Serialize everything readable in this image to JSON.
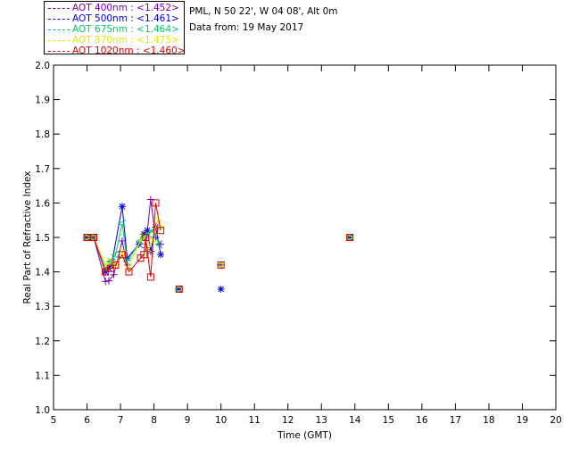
{
  "header": {
    "site_line": "PML, N 50 22', W 04 08', Alt 0m",
    "date_line": "Data from: 19 May 2017"
  },
  "legend": [
    {
      "label": "AOT  400nm : <1.452>",
      "color": "#7b00b8"
    },
    {
      "label": "AOT  500nm : <1.461>",
      "color": "#0000dd"
    },
    {
      "label": "AOT  675nm : <1.464>",
      "color": "#00cc66"
    },
    {
      "label": "AOT  870nm : <1.475>",
      "color": "#e6e600"
    },
    {
      "label": "AOT 1020nm : <1.460>",
      "color": "#dd0000"
    }
  ],
  "chart_data": {
    "type": "scatter",
    "xlabel": "Time (GMT)",
    "ylabel": "Real Part of Refractive Index",
    "xlim": [
      5,
      20
    ],
    "ylim": [
      1.0,
      2.0
    ],
    "xticks": [
      "5",
      "6",
      "7",
      "8",
      "9",
      "10",
      "11",
      "12",
      "13",
      "14",
      "15",
      "16",
      "17",
      "18",
      "19",
      "20"
    ],
    "yticks": [
      "1.0",
      "1.1",
      "1.2",
      "1.3",
      "1.4",
      "1.5",
      "1.6",
      "1.7",
      "1.8",
      "1.9",
      "2.0"
    ],
    "series": [
      {
        "name": "AOT  400nm",
        "color": "#7b00b8",
        "marker": "plus",
        "x": [
          6.0,
          6.2,
          6.55,
          6.65,
          6.8,
          7.05,
          7.2,
          7.75,
          7.9,
          8.05,
          8.2,
          8.75,
          10.0,
          13.85
        ],
        "y": [
          1.5,
          1.5,
          1.372,
          1.374,
          1.392,
          1.49,
          1.42,
          1.47,
          1.61,
          1.5,
          1.48,
          1.35,
          1.42,
          1.5
        ]
      },
      {
        "name": "AOT  500nm",
        "color": "#0000dd",
        "marker": "star",
        "x": [
          6.0,
          6.2,
          6.55,
          6.65,
          6.75,
          7.05,
          7.2,
          7.55,
          7.7,
          7.8,
          7.9,
          8.05,
          8.2,
          8.75,
          10.0,
          13.85
        ],
        "y": [
          1.5,
          1.5,
          1.4,
          1.41,
          1.43,
          1.59,
          1.44,
          1.48,
          1.51,
          1.52,
          1.46,
          1.53,
          1.45,
          1.35,
          1.35,
          1.5
        ]
      },
      {
        "name": "AOT  675nm",
        "color": "#00cc66",
        "marker": "lt",
        "x": [
          6.0,
          6.2,
          6.55,
          6.7,
          6.85,
          7.05,
          7.2,
          7.6,
          7.7,
          7.85,
          8.0,
          8.15,
          8.75,
          10.0,
          13.85
        ],
        "y": [
          1.5,
          1.5,
          1.41,
          1.43,
          1.45,
          1.54,
          1.43,
          1.49,
          1.5,
          1.51,
          1.52,
          1.48,
          1.35,
          1.42,
          1.5
        ]
      },
      {
        "name": "AOT  870nm",
        "color": "#e6e600",
        "marker": "gt",
        "x": [
          6.0,
          6.2,
          6.55,
          6.7,
          6.85,
          7.05,
          7.2,
          7.65,
          7.8,
          7.95,
          8.1,
          8.2,
          8.75,
          10.0,
          13.85
        ],
        "y": [
          1.5,
          1.5,
          1.42,
          1.43,
          1.42,
          1.46,
          1.41,
          1.5,
          1.46,
          1.49,
          1.55,
          1.53,
          1.35,
          1.42,
          1.5
        ]
      },
      {
        "name": "AOT 1020nm",
        "color": "#dd0000",
        "marker": "square",
        "x": [
          6.0,
          6.2,
          6.55,
          6.7,
          6.85,
          7.05,
          7.25,
          7.6,
          7.7,
          7.75,
          7.9,
          8.05,
          8.2,
          8.75,
          10.0,
          13.85
        ],
        "y": [
          1.5,
          1.5,
          1.4,
          1.41,
          1.42,
          1.45,
          1.4,
          1.44,
          1.45,
          1.5,
          1.385,
          1.6,
          1.52,
          1.35,
          1.42,
          1.5
        ]
      }
    ]
  }
}
